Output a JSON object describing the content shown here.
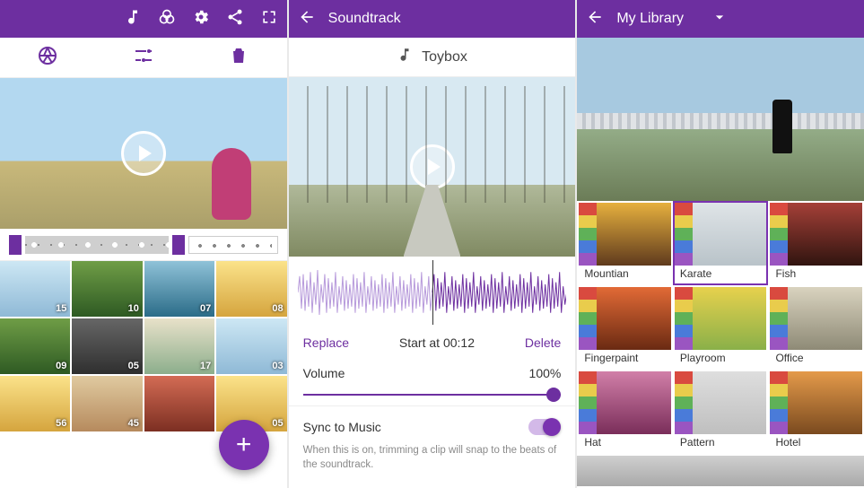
{
  "panel1": {
    "clips": [
      {
        "dur": "15",
        "cls": "sky"
      },
      {
        "dur": "10",
        "cls": "green"
      },
      {
        "dur": "07",
        "cls": "water"
      },
      {
        "dur": "08",
        "cls": "food"
      },
      {
        "dur": "09",
        "cls": "green"
      },
      {
        "dur": "05",
        "cls": "dark"
      },
      {
        "dur": "17",
        "cls": "mix"
      },
      {
        "dur": "03",
        "cls": "sky"
      },
      {
        "dur": "56",
        "cls": "food"
      },
      {
        "dur": "45",
        "cls": "carousel"
      },
      {
        "dur": "",
        "cls": "red"
      },
      {
        "dur": "05",
        "cls": "food"
      }
    ]
  },
  "panel2": {
    "title": "Soundtrack",
    "track": "Toybox",
    "replace": "Replace",
    "startAt": "Start at 00:12",
    "del": "Delete",
    "volumeLabel": "Volume",
    "volumeValue": "100%",
    "syncLabel": "Sync to Music",
    "syncHint": "When this is on, trimming a clip will snap to the beats of the soundtrack."
  },
  "panel3": {
    "title": "My Library",
    "items": [
      {
        "label": "Mountian",
        "cls": "li-mountain",
        "selected": false
      },
      {
        "label": "Karate",
        "cls": "li-karate",
        "selected": true
      },
      {
        "label": "Fish",
        "cls": "li-fish",
        "selected": false
      },
      {
        "label": "Fingerpaint",
        "cls": "li-finger",
        "selected": false
      },
      {
        "label": "Playroom",
        "cls": "li-play",
        "selected": false
      },
      {
        "label": "Office",
        "cls": "li-office",
        "selected": false
      },
      {
        "label": "Hat",
        "cls": "li-hat",
        "selected": false
      },
      {
        "label": "Pattern",
        "cls": "li-pattern",
        "selected": false
      },
      {
        "label": "Hotel",
        "cls": "li-hotel",
        "selected": false
      }
    ]
  }
}
